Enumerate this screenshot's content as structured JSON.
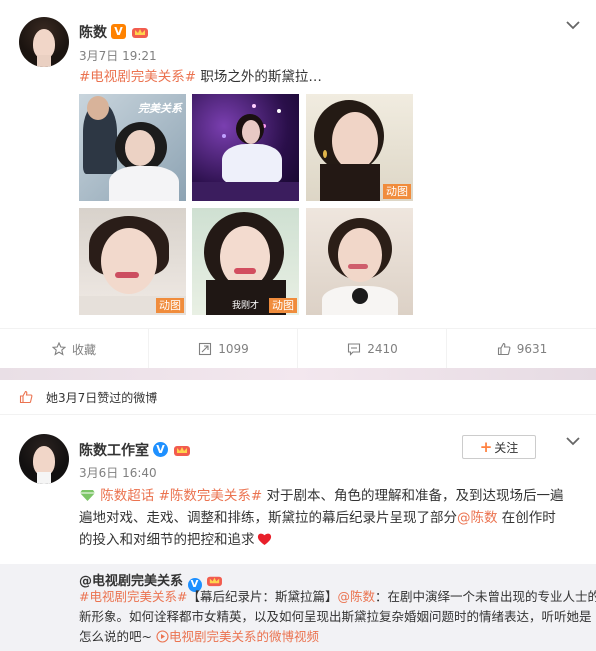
{
  "post1": {
    "user": "陈数",
    "time": "3月7日 19:21",
    "topic": "#电视剧完美关系#",
    "text": " 职场之外的斯黛拉…",
    "photo_watermark": "完美关系",
    "photo_caption": "我刚才",
    "badge_text": "动图",
    "actions": {
      "fav": "收藏",
      "repost": "1099",
      "comment": "2410",
      "like": "9631"
    }
  },
  "liked_notice": "她3月7日赞过的微博",
  "post2": {
    "user": "陈数工作室",
    "time": "3月6日 16:40",
    "follow": "关注",
    "super_topic": "陈数超话",
    "topic": "#陈数完美关系#",
    "text_a": " 对于剧本、角色的理解和准备，及到达现场后一遍",
    "text_b": "遍地对戏、走戏、调整和排练，斯黛拉的幕后纪录片呈现了部分",
    "mention": "@陈数",
    "text_c": " 在创作时",
    "text_d": "的投入和对细节的把控和追求"
  },
  "repost": {
    "user": "@电视剧完美关系",
    "topic": "#电视剧完美关系#",
    "l1_a": "【幕后纪录片：斯黛拉篇】",
    "mention": "@陈数",
    "l1_b": "：在剧中演绎一个未曾出现的专业人士的",
    "l2": "新形象。如何诠释都市女精英，以及如何呈现出斯黛拉复杂婚姻问题时的情绪表达，听听她是",
    "l3": "怎么说的吧~ ",
    "video_link": "电视剧完美关系的微博视频"
  },
  "colors": {
    "accent": "#eb7350",
    "link": "#eb7350",
    "badge": "#f08c3c"
  }
}
